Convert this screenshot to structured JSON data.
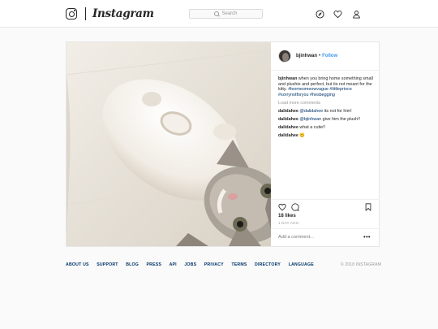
{
  "header": {
    "wordmark": "Instagram",
    "search_placeholder": "Search",
    "icons": [
      "instagram-camera-icon",
      "compass-icon",
      "heart-icon",
      "profile-icon"
    ]
  },
  "post": {
    "username": "bjinhwan",
    "separator": "•",
    "follow_label": "Follow",
    "caption": {
      "user": "bjinhwan",
      "text": "when you bring home something small and plushie and perfect, but its not meant for the kitty.",
      "tags": "#leomeomeowvague #littleprince #sorrynotforyou #hesbegging"
    },
    "load_more": "Load more comments",
    "comments": [
      {
        "user": "dalidahee",
        "mention": "@dalidahee",
        "text": "its not for him!"
      },
      {
        "user": "dalidahee",
        "mention": "@bjinhwan",
        "text": "give him the plush!!"
      },
      {
        "user": "dalidahee",
        "text": "what a cutie!!"
      },
      {
        "user": "dalidahee",
        "text": "😊"
      }
    ],
    "likes": "18 likes",
    "time": "1 DAY AGO",
    "add_comment_placeholder": "Add a comment...",
    "more_label": "•••",
    "icons": [
      "heart-outline-icon",
      "comment-icon",
      "bookmark-icon"
    ]
  },
  "footer": {
    "links": [
      "ABOUT US",
      "SUPPORT",
      "BLOG",
      "PRESS",
      "API",
      "JOBS",
      "PRIVACY",
      "TERMS",
      "DIRECTORY",
      "LANGUAGE"
    ],
    "copyright": "© 2018 INSTAGRAM"
  },
  "colors": {
    "link_blue": "#3897f0",
    "dark_blue": "#003569",
    "border": "#e6e6e6",
    "background": "#fafafa"
  }
}
